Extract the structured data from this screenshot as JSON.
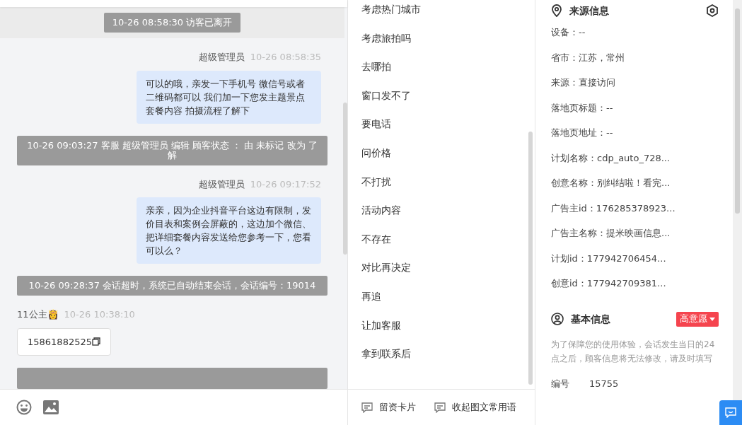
{
  "chat": {
    "messages": [
      {
        "kind": "banner",
        "text": "10-26 08:58:30 访客已离开"
      },
      {
        "kind": "agent",
        "sender": "超级管理员",
        "time": "10-26 08:58:35",
        "text": "可以的哦，亲发一下手机号 微信号或者二维码都可以 我们加一下您发主题景点套餐内容 拍摄流程了解下"
      },
      {
        "kind": "system",
        "text": "10-26 09:03:27 客服 超级管理员 编辑 顾客状态 ： 由 未标记 改为 了解"
      },
      {
        "kind": "agent",
        "sender": "超级管理员",
        "time": "10-26 09:17:52",
        "text": "亲亲，因为企业抖音平台这边有限制，发价目表和案例会屏蔽的，这边加个微信、把详细套餐内容发送给您参考一下，您看可以么？"
      },
      {
        "kind": "system",
        "text": "10-26 09:28:37 会话超时，系统已自动结束会话，会话编号：19014"
      },
      {
        "kind": "visitor",
        "sender": "11公主",
        "emoji": "👸",
        "time": "10-26 10:38:10",
        "text": "15861882525"
      },
      {
        "kind": "cutoff"
      }
    ]
  },
  "quick_replies": {
    "items": [
      "考虑热门城市",
      "考虑旅拍吗",
      "去哪拍",
      "窗口发不了",
      "要电话",
      "问价格",
      "不打扰",
      "活动内容",
      "不存在",
      "对比再决定",
      "再追",
      "让加客服",
      "拿到联系后"
    ],
    "actions": [
      "留资卡片",
      "收起图文常用语"
    ]
  },
  "source_info": {
    "title": "来源信息",
    "fields": [
      "设备：--",
      "省市：江苏，常州",
      "来源：直接访问",
      "落地页标题：--",
      "落地页地址：--",
      "计划名称：cdp_auto_728...",
      "创意名称：别纠结啦！看完...",
      "广告主id：176285378923...",
      "广告主名称：提米映画信息...",
      "计划id：177942706454...",
      "创意id：177942709381..."
    ]
  },
  "basic_info": {
    "title": "基本信息",
    "intent": "高意愿",
    "notice": "为了保障您的使用体验，会话发生当日的24点之后，顾客信息将无法修改，请及时填写",
    "fields": [
      {
        "label": "编号",
        "value": "15755"
      }
    ]
  }
}
